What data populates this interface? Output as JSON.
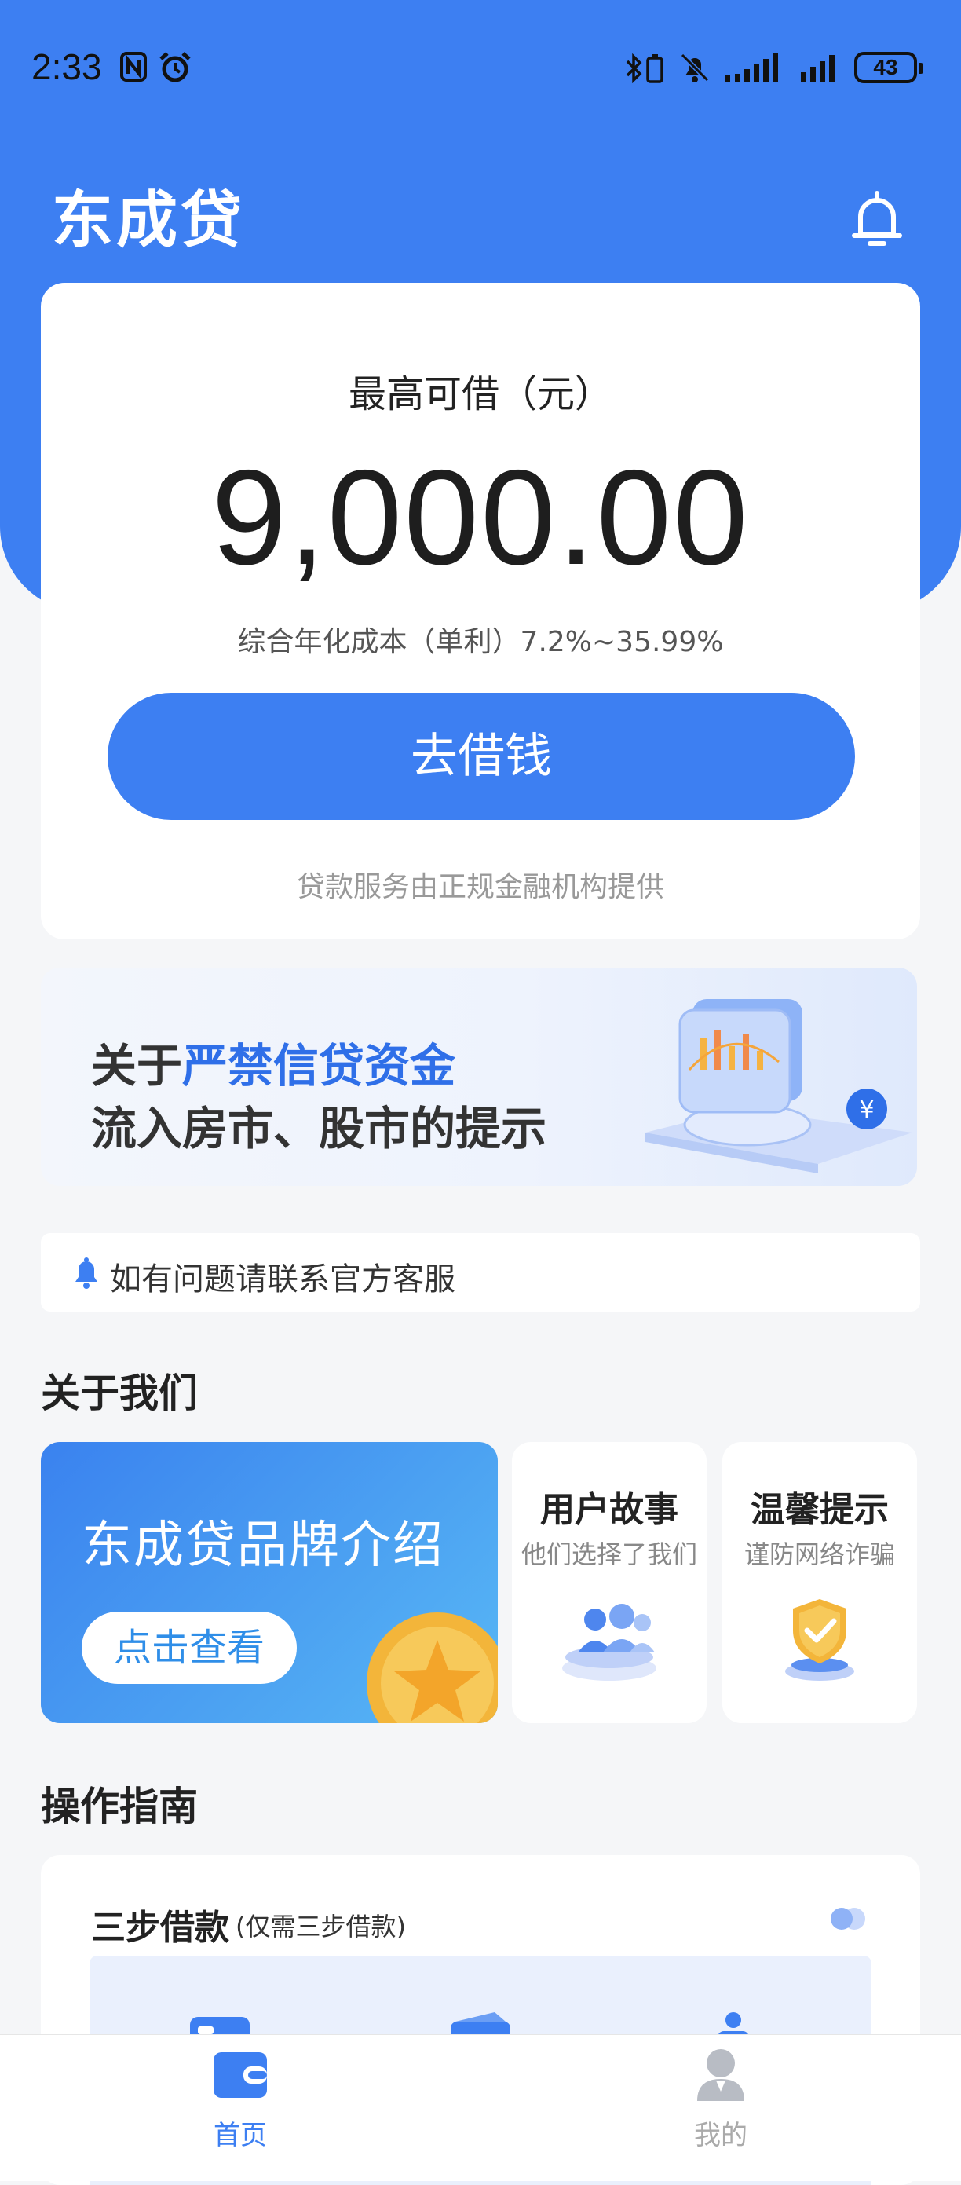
{
  "status_bar": {
    "time": "2:33",
    "battery": "43"
  },
  "header": {
    "app_title": "东成贷"
  },
  "loan_card": {
    "label": "最高可借（元）",
    "amount": "9,000.00",
    "rate_text": "综合年化成本（单利）7.2%~35.99%",
    "borrow_button": "去借钱",
    "provider_note": "贷款服务由正规金融机构提供"
  },
  "banner": {
    "line1_prefix": "关于",
    "line1_highlight": "严禁信贷资金",
    "line2": "流入房市、股市的提示"
  },
  "notice": {
    "text": "如有问题请联系官方客服"
  },
  "about": {
    "section_title": "关于我们",
    "brand_card": {
      "title": "东成贷品牌介绍",
      "button": "点击查看"
    },
    "story_card": {
      "title": "用户故事",
      "subtitle": "他们选择了我们"
    },
    "tips_card": {
      "title": "温馨提示",
      "subtitle": "谨防网络诈骗"
    }
  },
  "guide": {
    "section_title": "操作指南",
    "card_title": "三步借款",
    "card_subtitle": "(仅需三步借款)"
  },
  "tab_bar": {
    "home": "首页",
    "mine": "我的"
  },
  "colors": {
    "primary": "#3d7ff2",
    "background": "#f5f6f8",
    "highlight": "#2f6fe8"
  }
}
